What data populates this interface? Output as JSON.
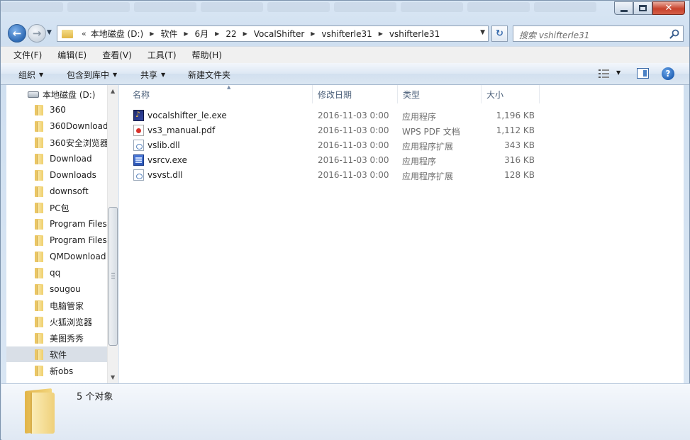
{
  "window": {
    "controls": {
      "minimize": "minimize-icon",
      "maximize": "maximize-icon",
      "close": "close-icon"
    }
  },
  "nav": {
    "back_icon": "back-arrow-icon",
    "forward_icon": "forward-arrow-icon",
    "breadcrumb_prefix": "«",
    "breadcrumbs": [
      "本地磁盘 (D:)",
      "软件",
      "6月",
      "22",
      "VocalShifter",
      "vshifterle31",
      "vshifterle31"
    ],
    "search_placeholder": "搜索 vshifterle31"
  },
  "menu": [
    "文件(F)",
    "编辑(E)",
    "查看(V)",
    "工具(T)",
    "帮助(H)"
  ],
  "commands": {
    "organize": "组织",
    "include_library": "包含到库中",
    "share": "共享",
    "new_folder": "新建文件夹"
  },
  "tree": {
    "drive": "本地磁盘 (D:)",
    "folders": [
      "360",
      "360Download",
      "360安全浏览器",
      "Download",
      "Downloads",
      "downsoft",
      "PC包",
      "Program Files",
      "Program Files",
      "QMDownload",
      "qq",
      "sougou",
      "电脑管家",
      "火狐浏览器",
      "美图秀秀",
      "软件",
      "新obs"
    ],
    "selected": "软件"
  },
  "columns": {
    "name": "名称",
    "date": "修改日期",
    "type": "类型",
    "size": "大小"
  },
  "files": [
    {
      "name": "vocalshifter_le.exe",
      "date": "2016-11-03 0:00",
      "type": "应用程序",
      "size": "1,196 KB",
      "icon": "vocalshifter-exe-icon"
    },
    {
      "name": "vs3_manual.pdf",
      "date": "2016-11-03 0:00",
      "type": "WPS PDF 文档",
      "size": "1,112 KB",
      "icon": "pdf-icon"
    },
    {
      "name": "vslib.dll",
      "date": "2016-11-03 0:00",
      "type": "应用程序扩展",
      "size": "343 KB",
      "icon": "dll-icon"
    },
    {
      "name": "vsrcv.exe",
      "date": "2016-11-03 0:00",
      "type": "应用程序",
      "size": "316 KB",
      "icon": "exe-icon"
    },
    {
      "name": "vsvst.dll",
      "date": "2016-11-03 0:00",
      "type": "应用程序扩展",
      "size": "128 KB",
      "icon": "dll-icon"
    }
  ],
  "details": {
    "count_text": "5 个对象"
  }
}
